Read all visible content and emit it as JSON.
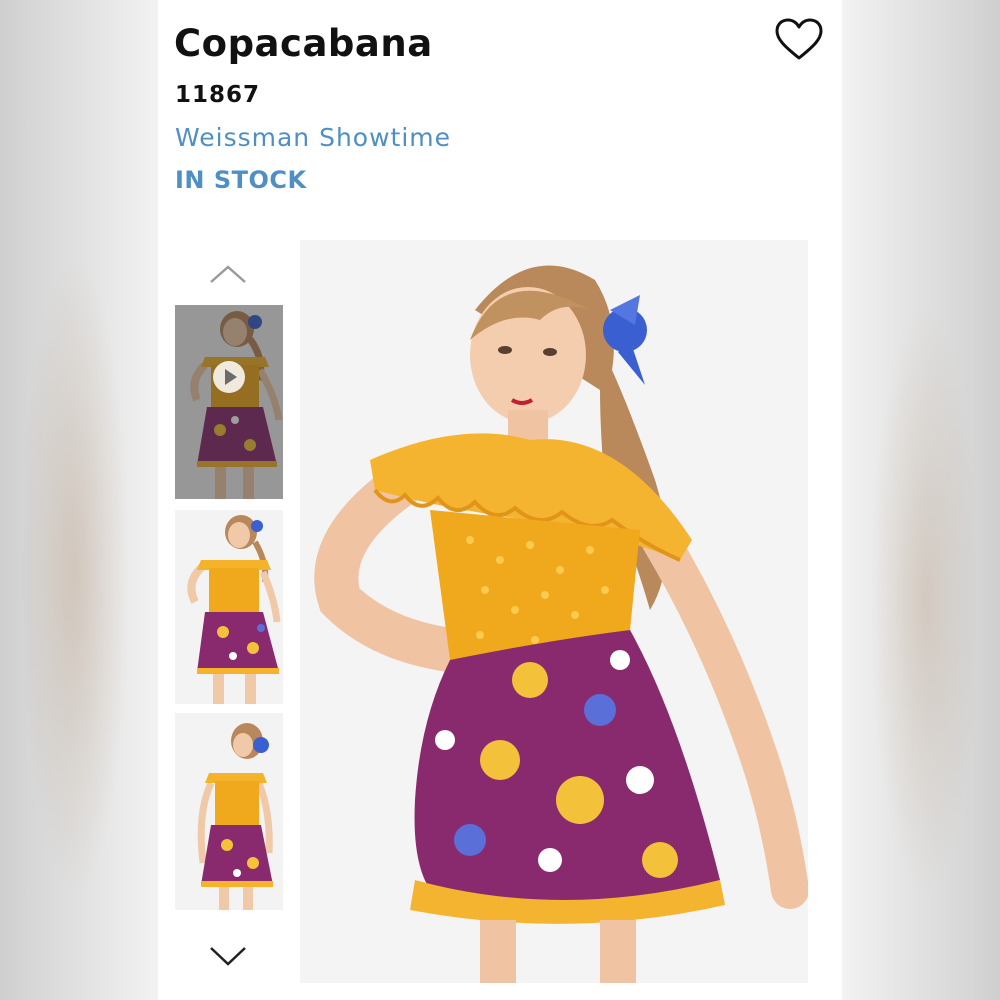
{
  "product": {
    "title": "Copacabana",
    "sku": "11867",
    "brand": "Weissman Showtime",
    "stock_status": "IN STOCK"
  },
  "icons": {
    "favorite": "heart-outline-icon",
    "scroll_up": "chevron-up-icon",
    "scroll_down": "chevron-down-icon",
    "video": "play-icon"
  },
  "gallery": {
    "thumbnails": [
      {
        "view": "front-video",
        "has_video": true,
        "selected": true
      },
      {
        "view": "front",
        "has_video": false,
        "selected": false
      },
      {
        "view": "back",
        "has_video": false,
        "selected": false
      }
    ]
  },
  "colors": {
    "brand_blue": "#4f8fc4",
    "top_gold": "#f0a81c",
    "skirt_purple": "#8a2a6e",
    "hair_accent_blue": "#3a5fd0"
  }
}
